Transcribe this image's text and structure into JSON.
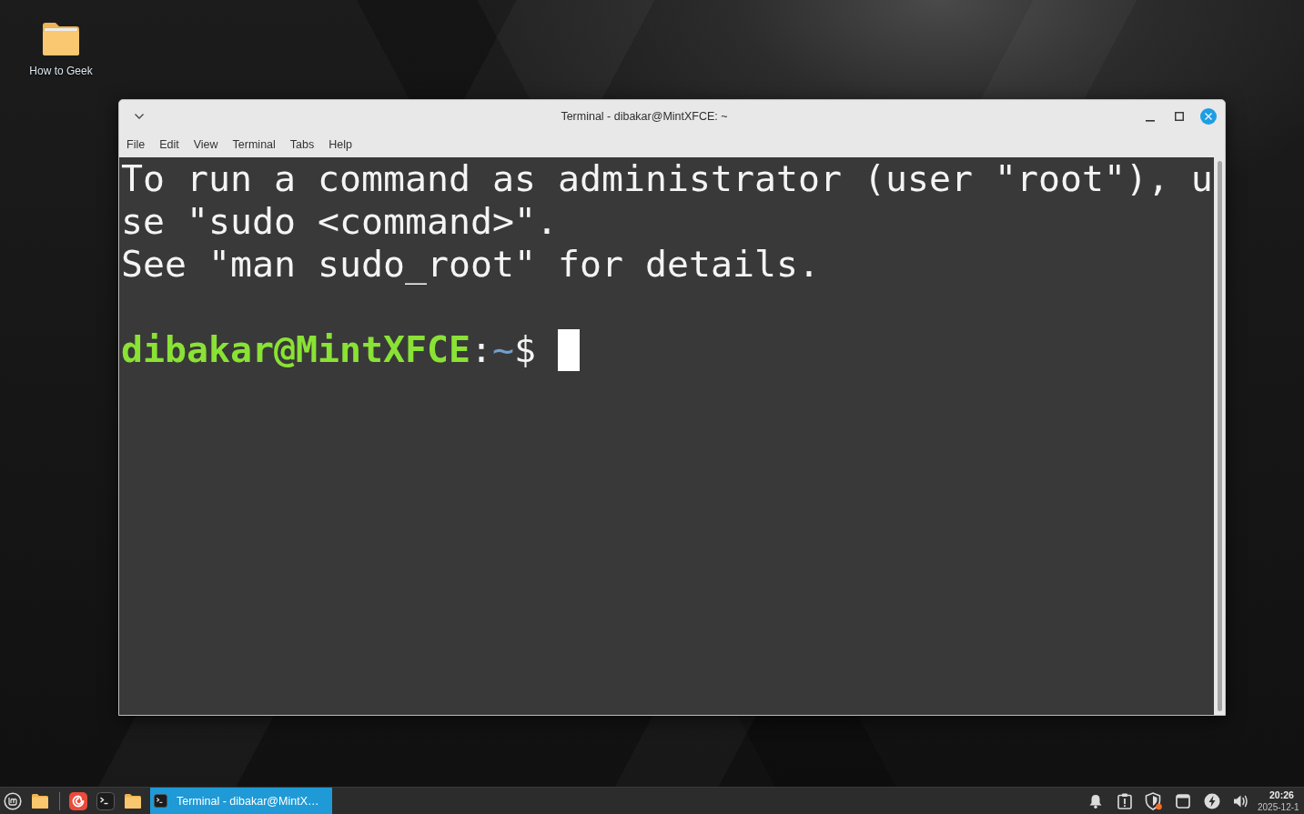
{
  "desktop": {
    "icons": [
      {
        "label": "How to Geek"
      }
    ]
  },
  "window": {
    "title": "Terminal - dibakar@MintXFCE: ~",
    "menu": [
      "File",
      "Edit",
      "View",
      "Terminal",
      "Tabs",
      "Help"
    ],
    "terminal": {
      "output": [
        "To run a command as administrator (user \"root\"), u",
        "se \"sudo <command>\".",
        "See \"man sudo_root\" for details."
      ],
      "prompt": {
        "user_host": "dibakar@MintXFCE",
        "separator": ":",
        "path": "~",
        "symbol": "$"
      }
    }
  },
  "taskbar": {
    "tasks": [
      {
        "label": "Terminal - dibakar@MintX…",
        "selected": true
      }
    ],
    "clock": {
      "time": "20:26",
      "date": "2025-12-1"
    }
  }
}
